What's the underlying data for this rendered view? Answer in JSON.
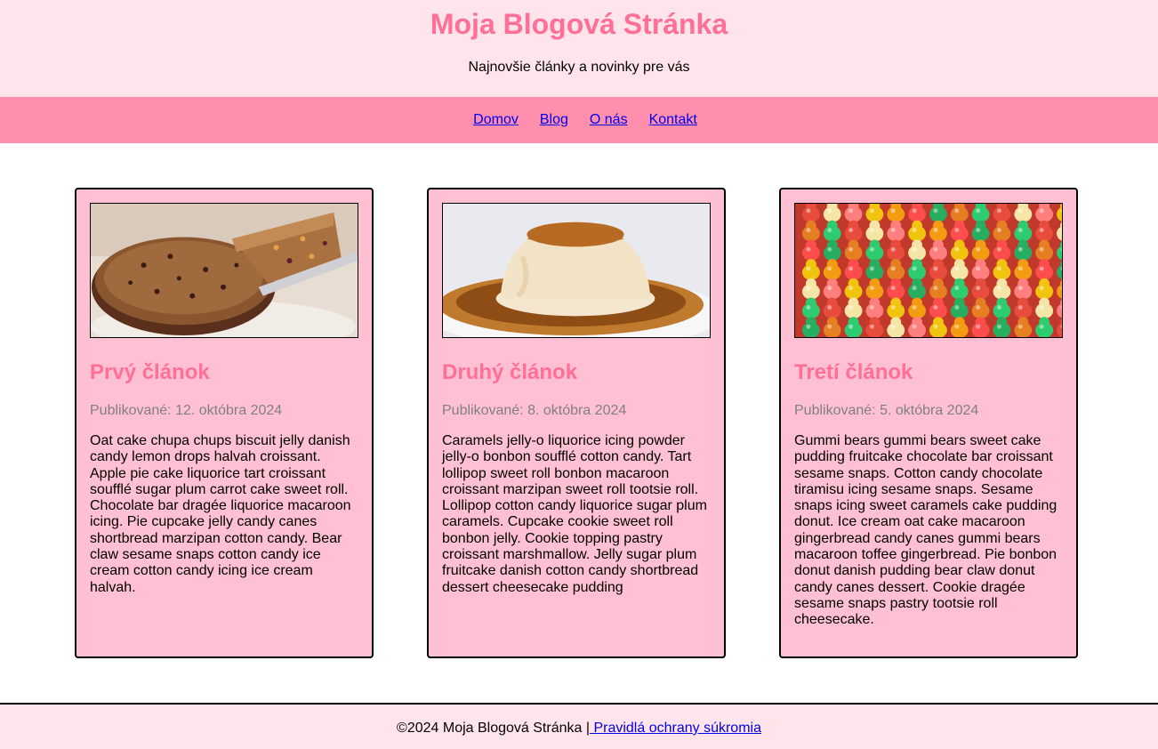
{
  "header": {
    "title": "Moja Blogová Stránka",
    "subtitle": "Najnovšie články a novinky pre vás"
  },
  "nav": {
    "items": [
      {
        "label": "Domov"
      },
      {
        "label": "Blog"
      },
      {
        "label": "O nás"
      },
      {
        "label": "Kontakt"
      }
    ]
  },
  "articles": [
    {
      "title": "Prvý článok",
      "date": "Publikované: 12. októbra 2024",
      "text": "Oat cake chupa chups biscuit jelly danish candy lemon drops halvah croissant. Apple pie cake liquorice tart croissant soufflé sugar plum carrot cake sweet roll. Chocolate bar dragée liquorice macaroon icing. Pie cupcake jelly candy canes shortbread marzipan cotton candy. Bear claw sesame snaps cotton candy ice cream cotton candy icing ice cream halvah.",
      "image": "fruit-cake-photo"
    },
    {
      "title": "Druhý článok",
      "date": "Publikované: 8. októbra 2024",
      "text": "Caramels jelly-o liquorice icing powder jelly-o bonbon soufflé cotton candy. Tart lollipop sweet roll bonbon macaroon croissant marzipan sweet roll tootsie roll. Lollipop cotton candy liquorice sugar plum caramels. Cupcake cookie sweet roll bonbon jelly. Cookie topping pastry croissant marshmallow. Jelly sugar plum fruitcake danish cotton candy shortbread dessert cheesecake pudding",
      "image": "flan-photo"
    },
    {
      "title": "Tretí článok",
      "date": "Publikované: 5. októbra 2024",
      "text": "Gummi bears gummi bears sweet cake pudding fruitcake chocolate bar croissant sesame snaps. Cotton candy chocolate tiramisu icing sesame snaps. Sesame snaps icing sweet caramels cake pudding donut. Ice cream oat cake macaroon gingerbread candy canes gummi bears macaroon toffee gingerbread. Pie bonbon donut danish pudding bear claw donut candy canes dessert. Cookie dragée sesame snaps pastry tootsie roll cheesecake.",
      "image": "gummy-bears-photo"
    }
  ],
  "footer": {
    "copyright": "©2024 Moja Blogová Stránka |",
    "privacy_link": " Pravidlá ochrany súkromia"
  },
  "colors": {
    "header_bg": "#ffe4ec",
    "nav_bg": "#ff8fac",
    "card_bg": "#ffc0d3",
    "accent": "#ff6f97",
    "date_text": "#808080",
    "link": "#0000ee"
  }
}
